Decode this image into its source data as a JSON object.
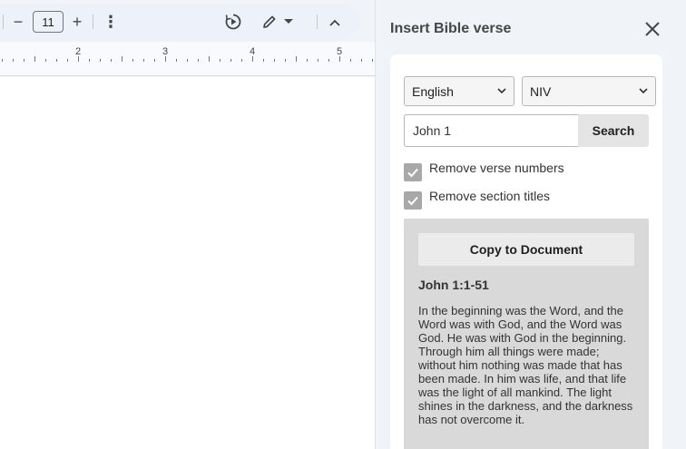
{
  "toolbar": {
    "font_size": "11",
    "minus_label": "−",
    "plus_label": "+",
    "more_label": "⋮"
  },
  "ruler": {
    "labels": [
      "2",
      "3",
      "4",
      "5"
    ]
  },
  "panel": {
    "title": "Insert Bible verse",
    "language": {
      "selected": "English"
    },
    "version": {
      "selected": "NIV"
    },
    "search": {
      "value": "John 1",
      "button_label": "Search"
    },
    "options": [
      {
        "label": "Remove verse numbers",
        "checked": true
      },
      {
        "label": "Remove section titles",
        "checked": true
      }
    ],
    "result": {
      "copy_label": "Copy to Document",
      "reference": "John 1:1-51",
      "text": "In the beginning was the Word, and the Word was with God, and the Word was God. He was with God in the beginning. Through him all things were made; without him nothing was made that has been made. In him was life, and that life was the light of all mankind. The light shines in the darkness, and the darkness has not overcome it."
    }
  },
  "icons": [
    "minus-icon",
    "plus-icon",
    "more-vert-icon",
    "voice-play-icon",
    "pen-edit-icon",
    "caret-down-icon",
    "chevron-up-icon",
    "close-icon",
    "chevron-down-icon",
    "check-icon"
  ]
}
